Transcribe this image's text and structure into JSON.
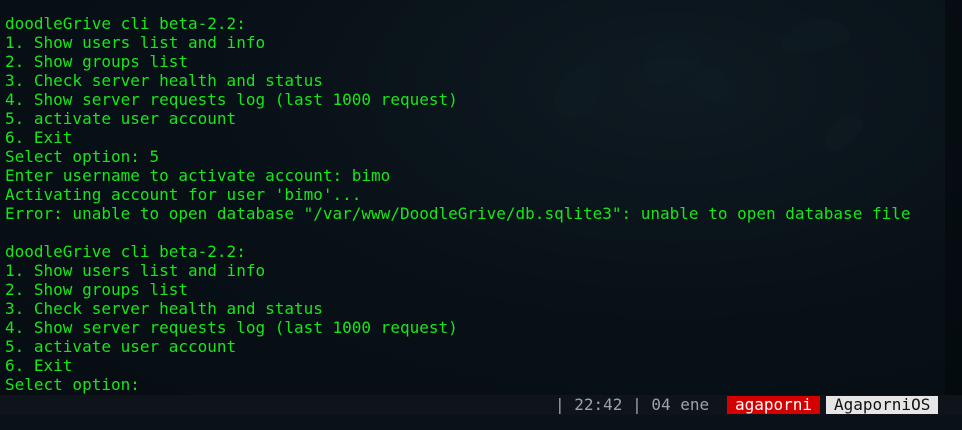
{
  "terminal": {
    "lines": [
      "doodleGrive cli beta-2.2:",
      "1. Show users list and info",
      "2. Show groups list",
      "3. Check server health and status",
      "4. Show server requests log (last 1000 request)",
      "5. activate user account",
      "6. Exit",
      "Select option: 5",
      "Enter username to activate account: bimo",
      "Activating account for user 'bimo'...",
      "Error: unable to open database \"/var/www/DoodleGrive/db.sqlite3\": unable to open database file",
      "",
      "doodleGrive cli beta-2.2:",
      "1. Show users list and info",
      "2. Show groups list",
      "3. Check server health and status",
      "4. Show server requests log (last 1000 request)",
      "5. activate user account",
      "6. Exit",
      "Select option:"
    ],
    "text_color": "#19e619"
  },
  "status_bar": {
    "time_date": "| 22:42 | 04 ene",
    "host": "agaporni",
    "os": "AgaporniOS",
    "host_bg": "#d40000",
    "os_bg": "#e6e6e6"
  }
}
